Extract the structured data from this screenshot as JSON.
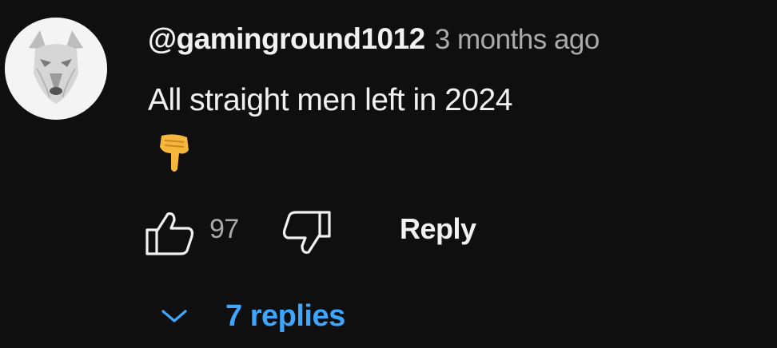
{
  "comment": {
    "author": "@gaminground1012",
    "time": "3 months ago",
    "text": "All straight men left in 2024",
    "emoji": "👇",
    "emoji_icon": "backhand-index-pointing-down-icon",
    "avatar_icon": "wolf-avatar-icon"
  },
  "actions": {
    "like_icon": "thumbs-up-icon",
    "like_count": "97",
    "dislike_icon": "thumbs-down-icon",
    "reply_label": "Reply"
  },
  "replies": {
    "chevron_icon": "chevron-down-icon",
    "label": "7 replies"
  },
  "colors": {
    "background": "#0f0f0f",
    "primary_text": "#f1f1f1",
    "secondary_text": "#aaaaaa",
    "link": "#3ea6ff",
    "emoji": "#f6b53b"
  }
}
